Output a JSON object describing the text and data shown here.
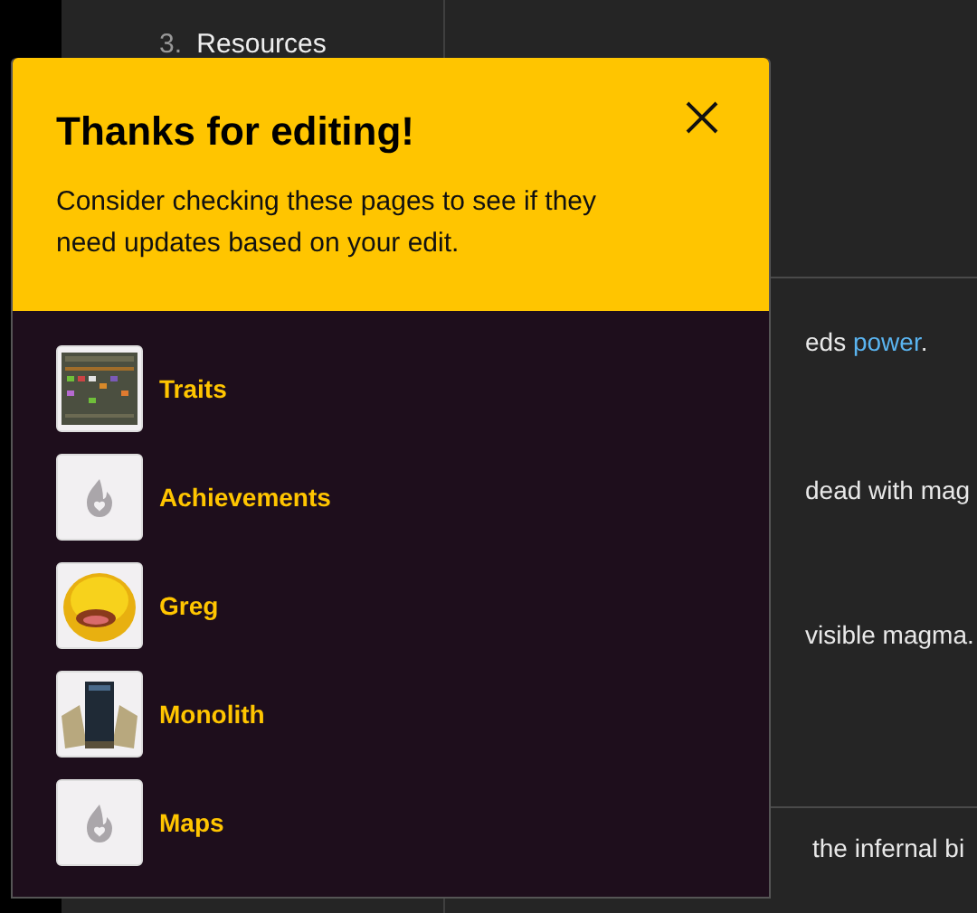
{
  "toc": [
    {
      "number": "3.",
      "label": "Resources"
    }
  ],
  "content": [
    {
      "kind": "link-sentence",
      "before": "eds ",
      "link": "power",
      "after": "."
    },
    {
      "kind": "text",
      "text": "dead with mag"
    },
    {
      "kind": "text",
      "text": "visible magma."
    },
    {
      "kind": "rule"
    },
    {
      "kind": "text",
      "text": "the infernal bi"
    }
  ],
  "popup": {
    "title": "Thanks for editing!",
    "message": "Consider checking these pages to see if they need updates based on your edit.",
    "pages": [
      {
        "title": "Traits",
        "kind": "picture"
      },
      {
        "title": "Achievements",
        "kind": "placeholder"
      },
      {
        "title": "Greg",
        "kind": "picture"
      },
      {
        "title": "Monolith",
        "kind": "picture"
      },
      {
        "title": "Maps",
        "kind": "placeholder"
      }
    ]
  }
}
